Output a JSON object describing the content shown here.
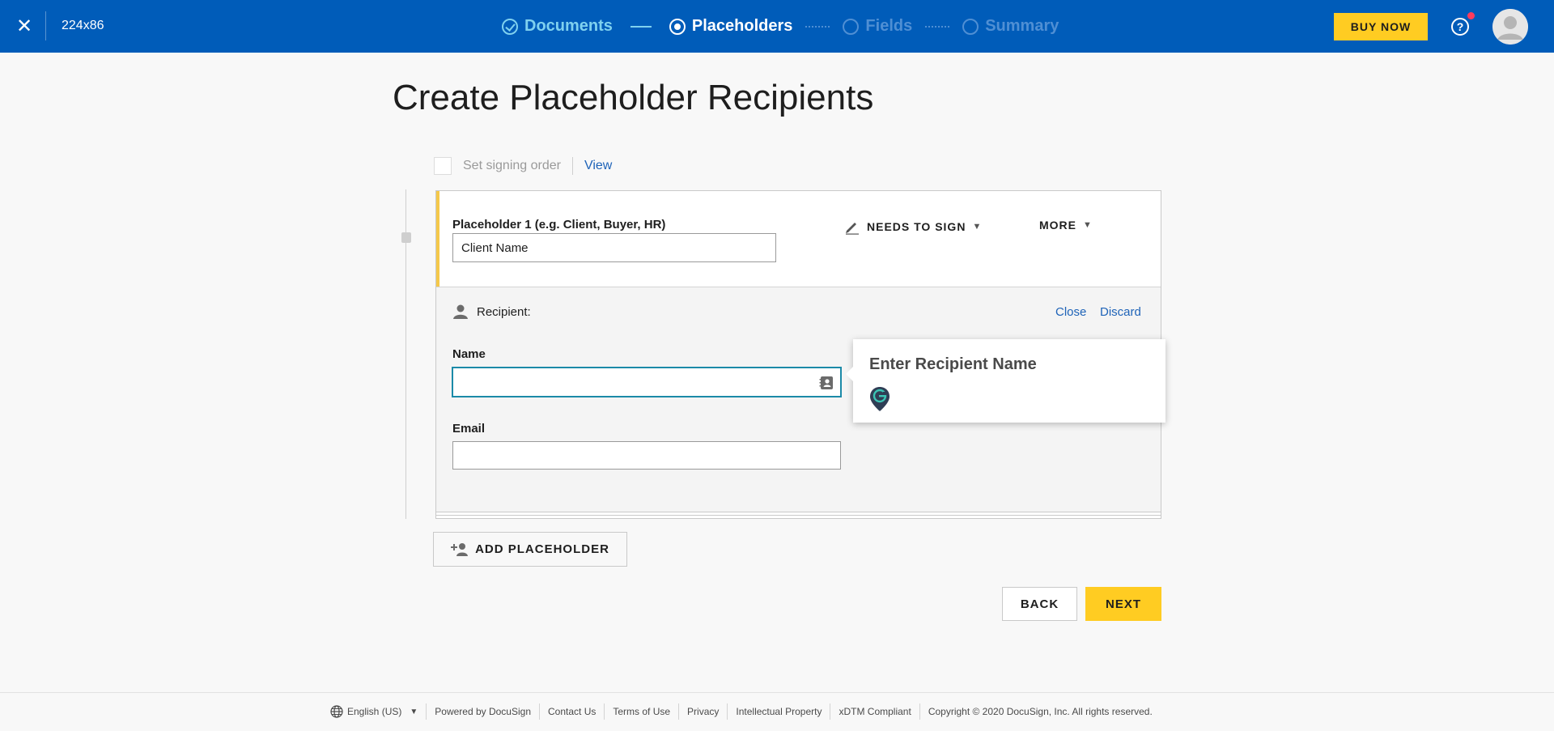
{
  "header": {
    "doc_title": "224x86",
    "steps": [
      {
        "label": "Documents",
        "state": "done"
      },
      {
        "label": "Placeholders",
        "state": "active"
      },
      {
        "label": "Fields",
        "state": "todo"
      },
      {
        "label": "Summary",
        "state": "todo"
      }
    ],
    "buy_label": "BUY NOW",
    "help_label": "?"
  },
  "main": {
    "title": "Create Placeholder Recipients",
    "signing_order_label": "Set signing order",
    "view_link": "View",
    "placeholder": {
      "label": "Placeholder 1 (e.g. Client, Buyer, HR)",
      "value": "Client Name",
      "action_label": "NEEDS TO SIGN",
      "more_label": "MORE"
    },
    "recipient": {
      "heading": "Recipient:",
      "close_link": "Close",
      "discard_link": "Discard",
      "name_label": "Name",
      "name_value": "",
      "email_label": "Email",
      "email_value": ""
    },
    "tooltip": {
      "title": "Enter Recipient Name"
    },
    "add_placeholder_label": "ADD PLACEHOLDER",
    "back_label": "BACK",
    "next_label": "NEXT"
  },
  "footer": {
    "language": "English (US)",
    "links": [
      "Powered by DocuSign",
      "Contact Us",
      "Terms of Use",
      "Privacy",
      "Intellectual Property",
      "xDTM Compliant"
    ],
    "copyright": "Copyright © 2020 DocuSign, Inc. All rights reserved."
  },
  "colors": {
    "header_bg": "#005cb9",
    "accent_yellow": "#ffcc22",
    "link_blue": "#1e63b8",
    "focus_teal": "#1b8aa8"
  }
}
